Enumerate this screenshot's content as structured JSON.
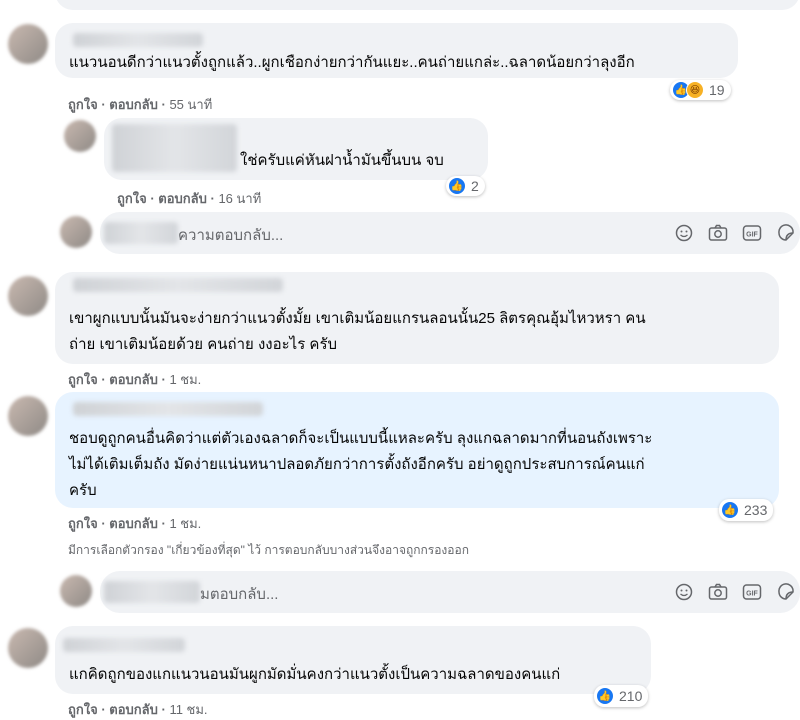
{
  "comments": [
    {
      "text_lines": [
        "แนวนอนดีกว่าแนวตั้งถูกแล้ว..ผูกเชือกง่ายกว่ากันแยะ..คนถ่ายแกล่ะ..ฉลาดน้อยกว่าลุงอีก"
      ],
      "like": "ถูกใจ",
      "reply": "ตอบกลับ",
      "time": "55 นาที",
      "reactions": [
        "like-icon",
        "haha-icon"
      ],
      "reaction_count": "19"
    },
    {
      "text_lines": [
        "ใช่ครับแค่หันฝาน้ำมันขึ้นบน จบ"
      ],
      "like": "ถูกใจ",
      "reply": "ตอบกลับ",
      "time": "16 นาที",
      "reactions": [
        "like-icon"
      ],
      "reaction_count": "2"
    },
    {
      "text_lines": [
        "เขาผูกแบบนั้นมันจะง่ายกว่าแนวตั้งมั้ย เขาเติมน้อยแกรนลอนนั้น25 ลิตรคุณอุ้มไหวหรา คน",
        "ถ่าย เขาเติมน้อยด้วย คนถ่าย งงอะไร ครับ"
      ],
      "like": "ถูกใจ",
      "reply": "ตอบกลับ",
      "time": "1 ชม."
    },
    {
      "text_lines": [
        "ชอบดูถูกคนอื่นคิดว่าแต่ตัวเองฉลาดก็จะเป็นแบบนี้แหละครับ ลุงแกฉลาดมากที่นอนถังเพราะ",
        "ไม่ได้เติมเต็มถัง มัดง่ายแน่นหนาปลอดภัยกว่าการตั้งถังอีกครับ อย่าดูถูกประสบการณ์คนแก่",
        "ครับ"
      ],
      "like": "ถูกใจ",
      "reply": "ตอบกลับ",
      "time": "1 ชม.",
      "reactions": [
        "like-icon"
      ],
      "reaction_count": "233"
    },
    {
      "text_lines": [
        "แกคิดถูกของแกแนวนอนมันผูกมัดมั่นคงกว่าแนวตั้งเป็นความฉลาดของคนแก่"
      ],
      "like": "ถูกใจ",
      "reply": "ตอบกลับ",
      "time": "11 ชม.",
      "reactions": [
        "like-icon"
      ],
      "reaction_count": "210"
    }
  ],
  "reply_boxes": [
    {
      "placeholder": "ความตอบกลับ..."
    },
    {
      "placeholder": "มตอบกลับ..."
    }
  ],
  "reply_icons": [
    "emoji-icon",
    "camera-icon",
    "gif-icon",
    "sticker-icon"
  ],
  "filter_notice": "มีการเลือกตัวกรอง \"เกี่ยวข้องที่สุด\" ไว้ การตอบกลับบางส่วนจึงอาจถูกกรองออก",
  "separator": " · ",
  "colors": {
    "bubble": "#f0f2f5",
    "highlight_bubble": "#e7f3ff",
    "like_blue": "#1877f2",
    "meta_gray": "#65676b"
  }
}
